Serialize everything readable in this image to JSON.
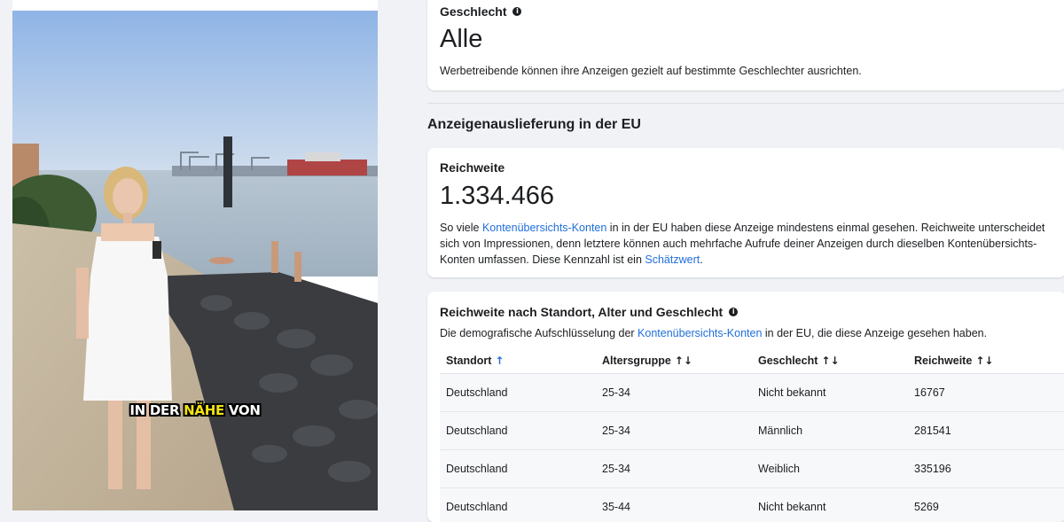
{
  "video": {
    "caption_parts": [
      "IN DER ",
      "NÄHE",
      " VON"
    ]
  },
  "gender_card": {
    "label": "Geschlecht",
    "value": "Alle",
    "description": "Werbetreibende können ihre Anzeigen gezielt auf bestimmte Geschlechter ausrichten."
  },
  "eu_section": {
    "title": "Anzeigenauslieferung in der EU"
  },
  "reach_card": {
    "label": "Reichweite",
    "value": "1.334.466",
    "desc_1": "So viele ",
    "link_1": "Kontenübersichts-Konten",
    "desc_2": " in in der EU haben diese Anzeige mindestens einmal gesehen. Reichweite unterscheidet sich von Impressionen, denn letztere können auch mehrfache Aufrufe deiner Anzeigen durch dieselben Kontenübersichts-Konten umfassen. Diese Kennzahl ist ein ",
    "link_2": "Schätzwert",
    "desc_3": "."
  },
  "breakdown_card": {
    "title": "Reichweite nach Standort, Alter und Geschlecht",
    "desc_1": "Die demografische Aufschlüsselung der ",
    "link": "Kontenübersichts-Konten",
    "desc_2": " in der EU, die diese Anzeige gesehen haben.",
    "columns": [
      "Standort",
      "Altersgruppe",
      "Geschlecht",
      "Reichweite"
    ],
    "sort_active": "↑",
    "sort_neutral": "↑↓",
    "rows": [
      [
        "Deutschland",
        "25-34",
        "Nicht bekannt",
        "16767"
      ],
      [
        "Deutschland",
        "25-34",
        "Männlich",
        "281541"
      ],
      [
        "Deutschland",
        "25-34",
        "Weiblich",
        "335196"
      ],
      [
        "Deutschland",
        "35-44",
        "Nicht bekannt",
        "5269"
      ]
    ]
  },
  "colors": {
    "link": "#216fdb",
    "background": "#f0f2f5",
    "caption_highlight": "#f3e312"
  }
}
